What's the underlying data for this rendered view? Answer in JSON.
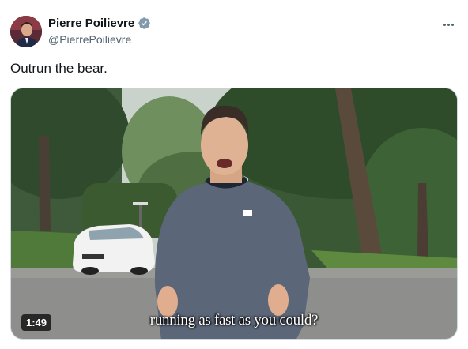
{
  "author": {
    "display_name": "Pierre Poilievre",
    "handle": "@PierrePoilievre",
    "verified": true,
    "avatar_icon": "profile-photo"
  },
  "tweet": {
    "text": "Outrun the bear."
  },
  "media": {
    "type": "video",
    "duration": "1:49",
    "caption": "running as fast as you could?"
  },
  "icons": {
    "verified": "verified-badge-icon",
    "more": "more-options-icon"
  },
  "colors": {
    "text": "#0f1419",
    "secondary": "#536471",
    "verified": "#829aab"
  }
}
